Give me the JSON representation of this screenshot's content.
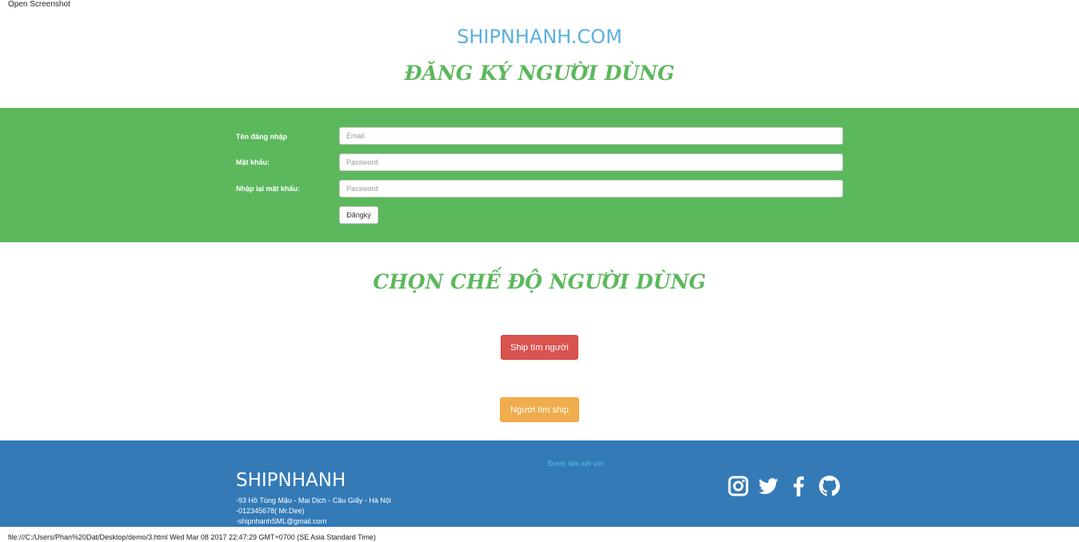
{
  "top_label": "Open Screenshot",
  "site_title": "SHIPNHANH.COM",
  "register": {
    "title": "ĐĂNG KÝ NGƯỜI DÙNG",
    "username_label": "Tên đăng nhập",
    "username_placeholder": "Email",
    "password_label": "Mật khẩu:",
    "password_placeholder": "Password",
    "confirm_label": "Nhập lại mật khẩu:",
    "confirm_placeholder": "Password",
    "submit_label": "Đăngký"
  },
  "mode": {
    "title": "CHỌN CHẾ ĐỘ NGƯỜI DÙNG",
    "ship_find_person": "Ship tìm người",
    "person_find_ship": "Người tìm ship"
  },
  "footer": {
    "brand": "SHIPNHANH",
    "address": "-93 Hồ Tùng Mậu - Mai Dịch - Cầu Giấy - Hà Nội",
    "phone": "-012345678( Mr.Dee)",
    "email": "-shipnhanhSML@gmail.com",
    "linked_label": "Được liên kết với:",
    "social_icons": [
      "instagram-icon",
      "twitter-icon",
      "facebook-icon",
      "github-icon"
    ]
  },
  "status_bar": "file:///C:/Users/Phan%20Dat/Desktop/demo/3.html Wed Mar 08 2017 22:47:29 GMT+0700 (SE Asia Standard Time)",
  "colors": {
    "green": "#5cb85c",
    "blue": "#337ab7",
    "light_blue": "#5bb0de",
    "red": "#d9534f",
    "orange": "#f0ad4e"
  }
}
